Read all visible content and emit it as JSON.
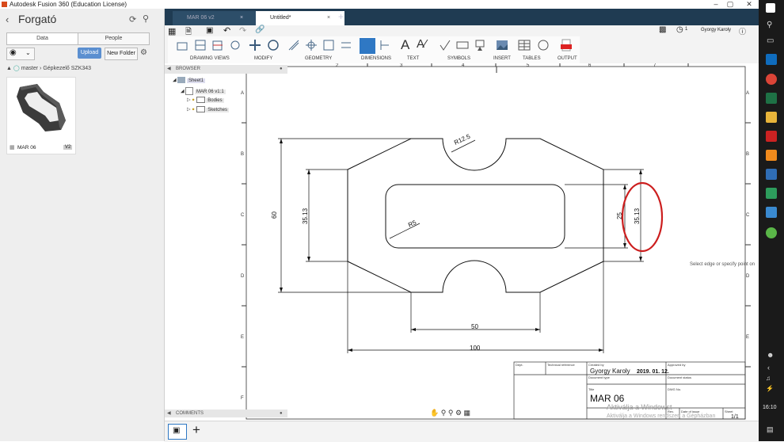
{
  "app": {
    "title": "Autodesk Fusion 360 (Education License)"
  },
  "data_panel": {
    "project_title": "Forgató",
    "tabs": [
      "Data",
      "People"
    ],
    "upload_label": "Upload",
    "new_folder_label": "New Folder",
    "breadcrumb_branch": "master",
    "breadcrumb_folder": "Gépkezelő SZK343",
    "file_name": "MAR 06",
    "file_version": "V2"
  },
  "doc_tabs": [
    {
      "label": "MAR 06 v2",
      "active": false
    },
    {
      "label": "Untitled*",
      "active": true
    }
  ],
  "header": {
    "user": "Gyorgy Karoly",
    "jobs_count": "1"
  },
  "toolbar": {
    "groups": [
      "DRAWING VIEWS",
      "MODIFY",
      "GEOMETRY",
      "DIMENSIONS",
      "TEXT",
      "SYMBOLS",
      "INSERT",
      "TABLES",
      "OUTPUT"
    ]
  },
  "browser": {
    "title": "BROWSER",
    "sheet": "Sheet1",
    "component": "MAR 06 v1:1",
    "children": [
      "Bodies",
      "Sketches"
    ]
  },
  "comments": {
    "title": "COMMENTS"
  },
  "drawing": {
    "col_labels": [
      "2",
      "3",
      "4",
      "5",
      "6",
      "7"
    ],
    "row_labels": [
      "A",
      "B",
      "C",
      "D",
      "E",
      "F"
    ],
    "dims": {
      "r125": "R12.5",
      "r5": "R5",
      "h60": "60",
      "h3513_left": "35.13",
      "h25": "25",
      "h3513_right": "35.13",
      "w50": "50",
      "w100": "100"
    },
    "title_block": {
      "dept": "Dept.",
      "tech_ref": "Technical reference",
      "created_by_label": "Created by",
      "approved_by_label": "Approved by",
      "created_by": "Gyorgy Karoly",
      "date": "2019. 01. 12.",
      "doc_type_label": "Document type",
      "doc_status_label": "Document status",
      "title_label": "Title",
      "dwg_label": "DWG No.",
      "title": "MAR 06",
      "rev_label": "Rev.",
      "date_issue_label": "Date of issue",
      "sheet_label": "Sheet",
      "sheet": "1/1",
      "watermark1": "Aktiválja a Windowst",
      "watermark2": "Aktiválja a Windows rendszert a Gépházban"
    }
  },
  "status": {
    "tooltip": "Select edge or specify point on"
  },
  "taskbar": {
    "time": "16:10"
  },
  "colors": {
    "accent": "#5b8fd0",
    "tabbar": "#1f3b52",
    "highlight": "#cc1e1e"
  }
}
